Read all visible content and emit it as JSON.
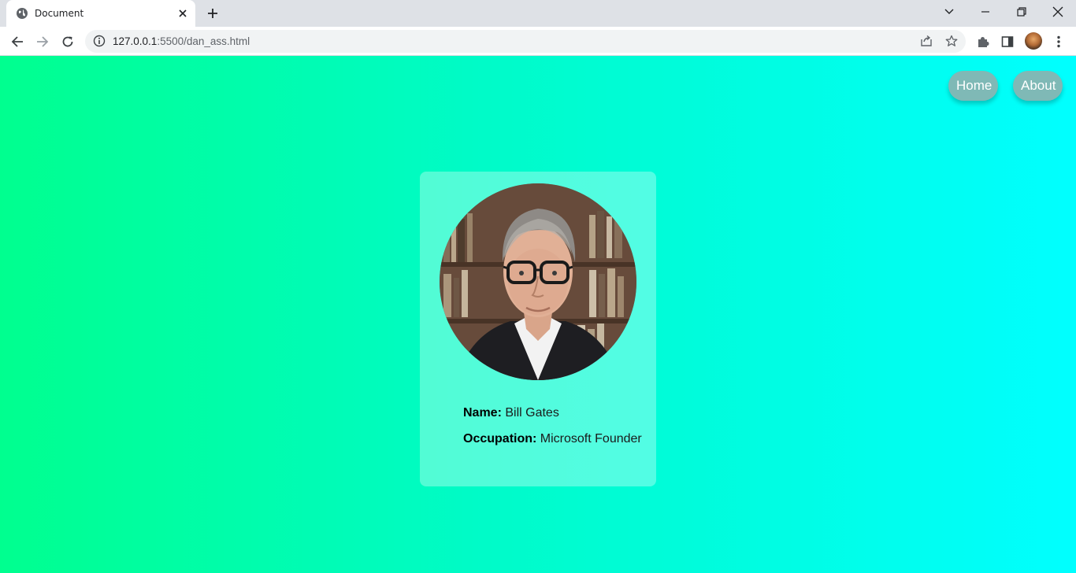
{
  "browser": {
    "tab_title": "Document",
    "url_host": "127.0.0.1",
    "url_path": ":5500/dan_ass.html"
  },
  "nav": {
    "home_label": "Home",
    "about_label": "About"
  },
  "profile": {
    "name_label": "Name:",
    "name_value": "Bill Gates",
    "occupation_label": "Occupation:",
    "occupation_value": "Microsoft Founder"
  },
  "colors": {
    "gradient_start": "#00ff8f",
    "gradient_end": "#00ffff",
    "nav_button": "#7fb9b6"
  }
}
